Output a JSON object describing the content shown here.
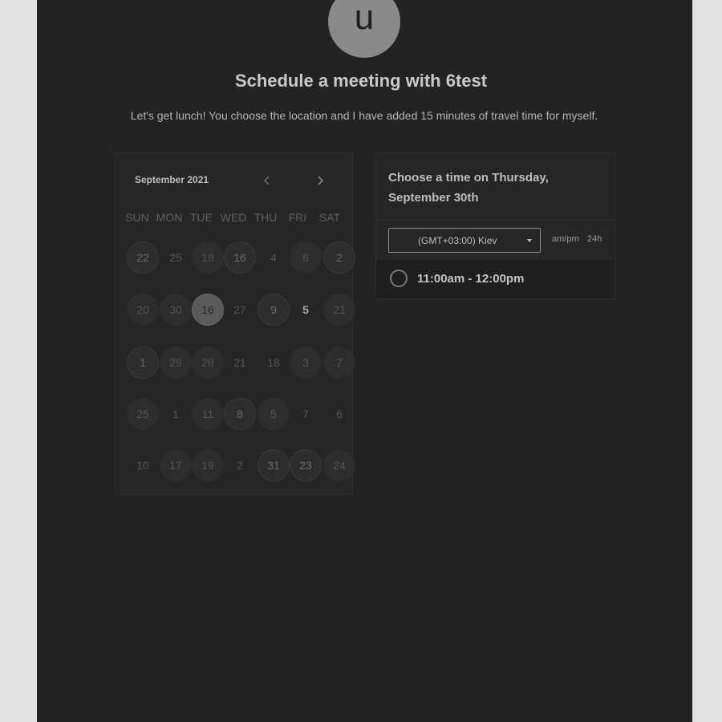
{
  "avatar": {
    "initial": "u"
  },
  "title": "Schedule a meeting with 6test",
  "subtitle": "Let's get lunch! You choose the location and I have added 15 minutes of travel time for myself.",
  "calendar": {
    "month_label": "September 2021",
    "weekdays": [
      "SUN",
      "MON",
      "TUE",
      "WED",
      "THU",
      "FRI",
      "SAT"
    ],
    "weeks": [
      [
        {
          "label": "22",
          "style": "dotted"
        },
        {
          "label": "25",
          "style": "plain"
        },
        {
          "label": "18",
          "style": "filled"
        },
        {
          "label": "16",
          "style": "dotted"
        },
        {
          "label": "4",
          "style": "plain"
        },
        {
          "label": "6",
          "style": "filled"
        },
        {
          "label": "2",
          "style": "dotted"
        }
      ],
      [
        {
          "label": "20",
          "style": "filled"
        },
        {
          "label": "30",
          "style": "filled"
        },
        {
          "label": "16",
          "style": "selected"
        },
        {
          "label": "27",
          "style": "plain"
        },
        {
          "label": "9",
          "style": "dotted"
        },
        {
          "label": "5",
          "style": "bold"
        },
        {
          "label": "21",
          "style": "filled"
        }
      ],
      [
        {
          "label": "1",
          "style": "dotted"
        },
        {
          "label": "29",
          "style": "filled"
        },
        {
          "label": "28",
          "style": "filled"
        },
        {
          "label": "21",
          "style": "plain"
        },
        {
          "label": "18",
          "style": "plain"
        },
        {
          "label": "3",
          "style": "filled"
        },
        {
          "label": "7",
          "style": "filled"
        }
      ],
      [
        {
          "label": "25",
          "style": "filled"
        },
        {
          "label": "1",
          "style": "plain"
        },
        {
          "label": "11",
          "style": "filled"
        },
        {
          "label": "8",
          "style": "dotted"
        },
        {
          "label": "5",
          "style": "filled"
        },
        {
          "label": "7",
          "style": "plain"
        },
        {
          "label": "6",
          "style": "plain"
        }
      ],
      [
        {
          "label": "10",
          "style": "plain"
        },
        {
          "label": "17",
          "style": "filled"
        },
        {
          "label": "19",
          "style": "filled"
        },
        {
          "label": "2",
          "style": "plain"
        },
        {
          "label": "31",
          "style": "dotted"
        },
        {
          "label": "23",
          "style": "dotted"
        },
        {
          "label": "24",
          "style": "filled"
        }
      ]
    ]
  },
  "times": {
    "heading_line1": "Choose a time on Thursday,",
    "heading_line2": "September 30th",
    "timezone": "(GMT+03:00) Kiev",
    "format_ampm": "am/pm",
    "format_24": "24h",
    "slots": [
      {
        "label": "11:00am - 12:00pm"
      }
    ]
  },
  "icons": {
    "prev": "chevron-left-icon",
    "next": "chevron-right-icon",
    "caret": "caret-down-icon"
  }
}
